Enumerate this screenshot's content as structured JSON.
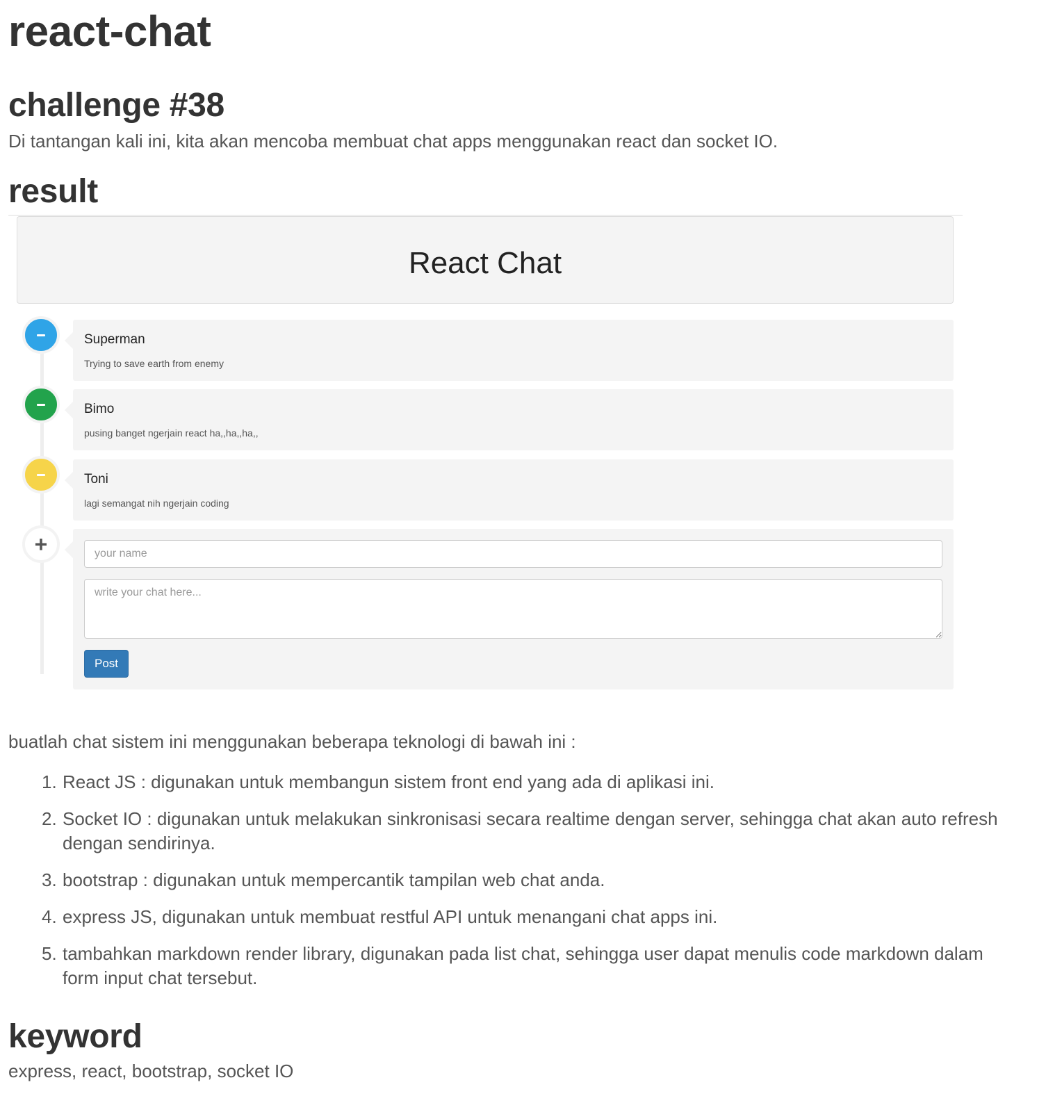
{
  "readme": {
    "title": "react-chat",
    "challenge_heading": "challenge #38",
    "challenge_text": "Di tantangan kali ini, kita akan mencoba membuat chat apps menggunakan react dan socket IO.",
    "result_heading": "result",
    "intro_text": "buatlah chat sistem ini menggunakan beberapa teknologi di bawah ini :",
    "tech_list": [
      "React JS : digunakan untuk membangun sistem front end yang ada di aplikasi ini.",
      "Socket IO : digunakan untuk melakukan sinkronisasi secara realtime dengan server, sehingga chat akan auto refresh dengan sendirinya.",
      "bootstrap : digunakan untuk mempercantik tampilan web chat anda.",
      "express JS, digunakan untuk membuat restful API untuk menangani chat apps ini.",
      "tambahkan markdown render library, digunakan pada list chat, sehingga user dapat menulis code markdown dalam form input chat tersebut."
    ],
    "keyword_heading": "keyword",
    "keyword_text": "express, react, bootstrap, socket IO"
  },
  "app": {
    "title": "React Chat",
    "messages": [
      {
        "name": "Superman",
        "text": "Trying to save earth from enemy",
        "badge_color": "#2fa4e7"
      },
      {
        "name": "Bimo",
        "text": "pusing banget ngerjain react ha,,ha,,ha,,",
        "badge_color": "#22a34c"
      },
      {
        "name": "Toni",
        "text": "lagi semangat nih ngerjain coding",
        "badge_color": "#f6d44a"
      }
    ],
    "form": {
      "name_placeholder": "your name",
      "chat_placeholder": "write your chat here...",
      "post_label": "Post"
    },
    "icons": {
      "message_badge": "minus-icon",
      "form_badge": "plus-icon"
    }
  }
}
